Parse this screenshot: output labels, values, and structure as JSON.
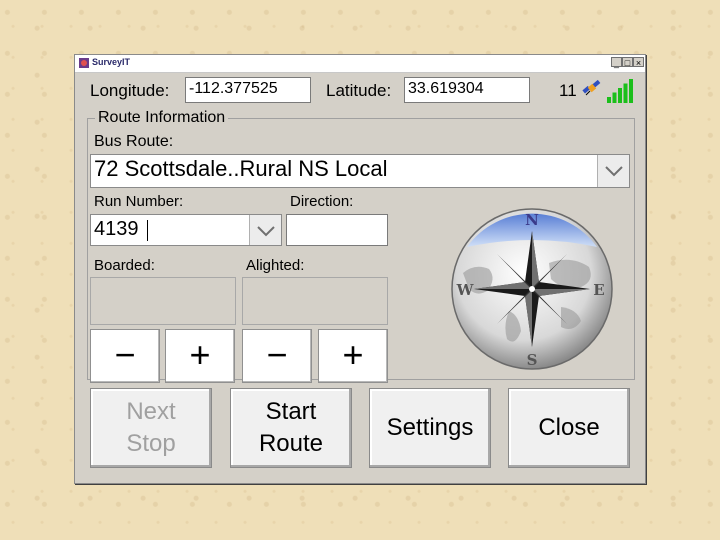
{
  "window": {
    "title": "SurveyIT",
    "min_glyph": "_",
    "max_glyph": "□",
    "close_glyph": "×"
  },
  "location": {
    "longitude_label": "Longitude:",
    "longitude_value": "-112.377525",
    "latitude_label": "Latitude:",
    "latitude_value": "33.619304",
    "satellite_count": "11",
    "signal_bars_lit": 5,
    "signal_bars_total": 5
  },
  "route_info": {
    "group_label": "Route Information",
    "bus_route_label": "Bus Route:",
    "bus_route_value": "72 Scottsdale..Rural NS Local",
    "run_number_label": "Run Number:",
    "run_number_value": "4139",
    "direction_label": "Direction:",
    "direction_value": "",
    "boarded_label": "Boarded:",
    "boarded_value": "",
    "alighted_label": "Alighted:",
    "alighted_value": ""
  },
  "compass": {
    "north": "N",
    "south": "S",
    "east": "E",
    "west": "W"
  },
  "steppers": {
    "minus": "−",
    "plus": "+"
  },
  "actions": {
    "next_stop": "Next Stop",
    "start_route": "Start Route",
    "settings": "Settings",
    "close": "Close"
  },
  "colors": {
    "window_bg": "#d4d0c8",
    "signal_green": "#1bbf1b",
    "compass_blue": "#7aa3e6",
    "disabled_text": "#a0a0a0"
  },
  "icons": {
    "satellite": "satellite-icon",
    "signal": "signal-strength-icon",
    "dropdown": "chevron-down-icon",
    "compass": "compass-rose-icon",
    "app": "app-icon"
  }
}
